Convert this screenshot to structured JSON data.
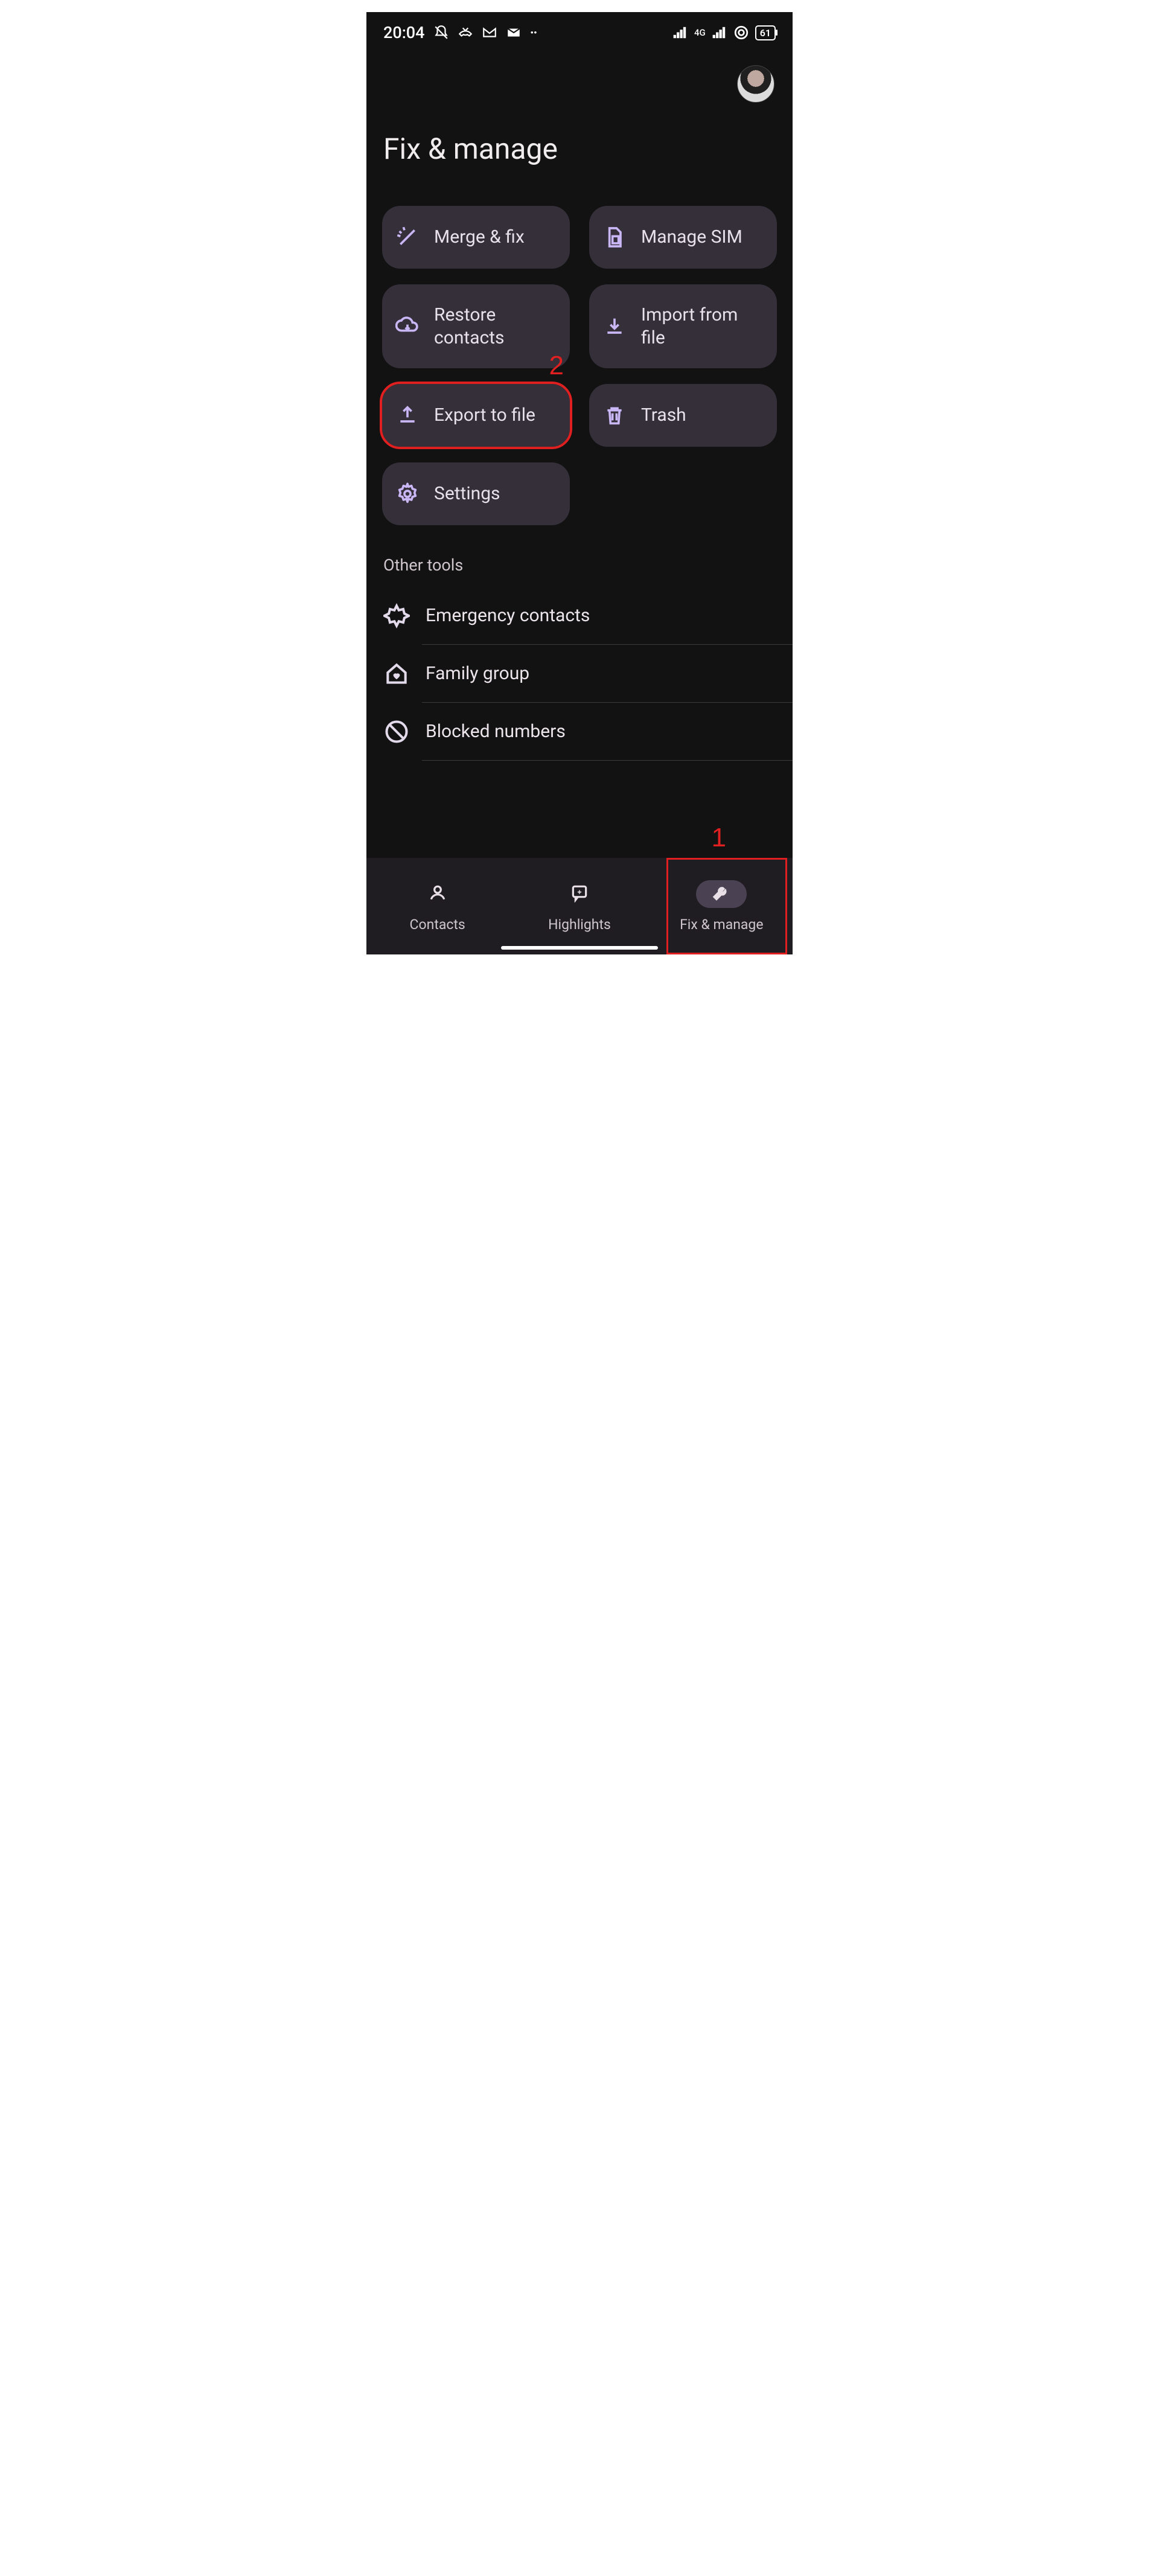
{
  "status_bar": {
    "time": "20:04",
    "battery": "61",
    "network_type": "4G"
  },
  "page": {
    "title": "Fix & manage"
  },
  "tiles": {
    "merge_fix": "Merge & fix",
    "manage_sim": "Manage SIM",
    "restore": "Restore contacts",
    "import": "Import from file",
    "export": "Export to file",
    "trash": "Trash",
    "settings": "Settings"
  },
  "other_tools": {
    "heading": "Other tools",
    "emergency": "Emergency contacts",
    "family": "Family group",
    "blocked": "Blocked numbers"
  },
  "bottom_nav": {
    "contacts": "Contacts",
    "highlights": "Highlights",
    "fix_manage": "Fix & manage"
  },
  "annotations": {
    "one": "1",
    "two": "2"
  }
}
